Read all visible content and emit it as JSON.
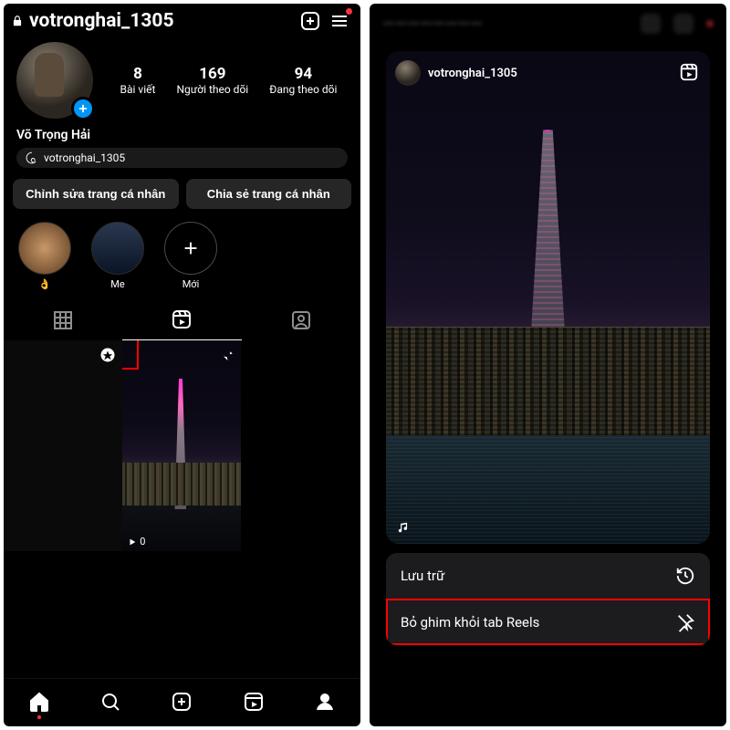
{
  "left": {
    "username": "votronghai_1305",
    "display_name": "Võ Trọng Hải",
    "threads_handle": "votronghai_1305",
    "stats": {
      "posts": {
        "count": "8",
        "label": "Bài viết"
      },
      "followers": {
        "count": "169",
        "label": "Người theo dõi"
      },
      "following": {
        "count": "94",
        "label": "Đang theo dõi"
      }
    },
    "actions": {
      "edit_profile": "Chỉnh sửa trang cá nhân",
      "share_profile": "Chia sẻ trang cá nhân"
    },
    "highlights": [
      {
        "label": "👌"
      },
      {
        "label": "Me"
      },
      {
        "label": "Mới"
      }
    ],
    "tabs": {
      "active": "reels"
    },
    "reel_thumb": {
      "views": "0"
    }
  },
  "right": {
    "reel_username": "votronghai_1305",
    "sheet": {
      "archive": "Lưu trữ",
      "unpin": "Bỏ ghim khỏi tab Reels"
    }
  }
}
